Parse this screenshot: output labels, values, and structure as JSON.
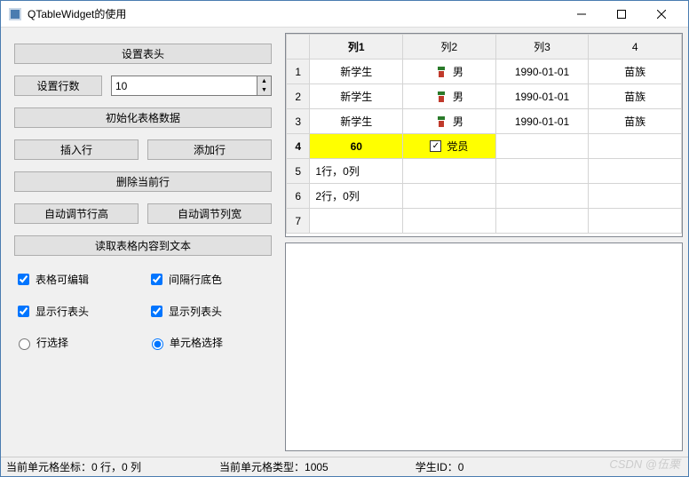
{
  "window": {
    "title": "QTableWidget的使用"
  },
  "leftPanel": {
    "setHeaderBtn": "设置表头",
    "setRowCountBtn": "设置行数",
    "rowCount": "10",
    "initDataBtn": "初始化表格数据",
    "insertRowBtn": "插入行",
    "addRowBtn": "添加行",
    "deleteRowBtn": "删除当前行",
    "autoRowHeightBtn": "自动调节行高",
    "autoColWidthBtn": "自动调节列宽",
    "readToTextBtn": "读取表格内容到文本",
    "checkEditable": "表格可编辑",
    "checkAltRow": "间隔行底色",
    "checkRowHeader": "显示行表头",
    "checkColHeader": "显示列表头",
    "radioRowSelect": "行选择",
    "radioCellSelect": "单元格选择"
  },
  "table": {
    "headers": [
      "列1",
      "列2",
      "列3",
      "4"
    ],
    "rows": [
      {
        "n": "1",
        "c1": "新学生",
        "c2": "男",
        "c3": "1990-01-01",
        "c4": "苗族",
        "icon": true
      },
      {
        "n": "2",
        "c1": "新学生",
        "c2": "男",
        "c3": "1990-01-01",
        "c4": "苗族",
        "icon": true
      },
      {
        "n": "3",
        "c1": "新学生",
        "c2": "男",
        "c3": "1990-01-01",
        "c4": "苗族",
        "icon": true
      }
    ],
    "row4": {
      "n": "4",
      "c1": "60",
      "c2": "党员"
    },
    "row5": {
      "n": "5",
      "c1": "1行，0列"
    },
    "row6": {
      "n": "6",
      "c1": "2行，0列"
    },
    "row7": {
      "n": "7"
    }
  },
  "status": {
    "coord": "当前单元格坐标：0 行，0 列",
    "type": "当前单元格类型：1005",
    "sid": "学生ID：0"
  },
  "watermark": "CSDN @伍栗"
}
